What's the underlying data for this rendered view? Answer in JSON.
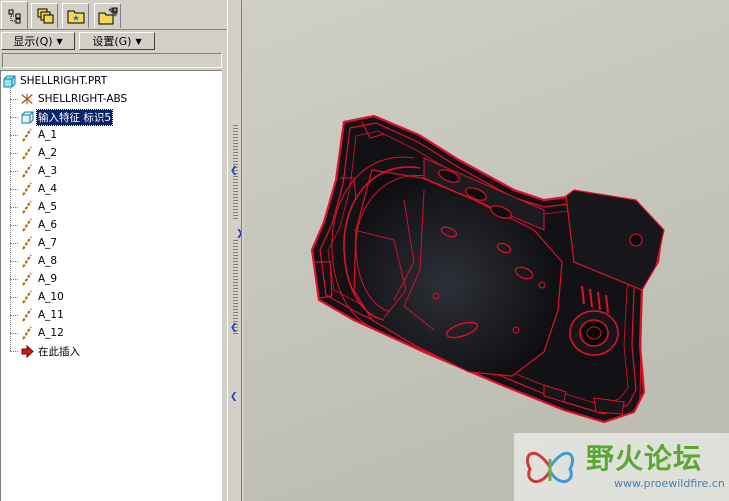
{
  "tabs": [
    {
      "icon": "model-tree-icon"
    },
    {
      "icon": "layers-icon"
    },
    {
      "icon": "folder-browser-icon"
    },
    {
      "icon": "favorites-icon"
    }
  ],
  "toolbar": {
    "show_label": "显示(Q)",
    "settings_label": "设置(G)"
  },
  "tree": {
    "root": "SHELLRIGHT.PRT",
    "items": [
      {
        "label": "SHELLRIGHT-ABS",
        "icon": "coordinate-system-icon",
        "selected": false
      },
      {
        "label": "输入特征 标识5",
        "icon": "import-feature-icon",
        "selected": true
      },
      {
        "label": "A_1",
        "icon": "datum-axis-icon",
        "selected": false
      },
      {
        "label": "A_2",
        "icon": "datum-axis-icon",
        "selected": false
      },
      {
        "label": "A_3",
        "icon": "datum-axis-icon",
        "selected": false
      },
      {
        "label": "A_4",
        "icon": "datum-axis-icon",
        "selected": false
      },
      {
        "label": "A_5",
        "icon": "datum-axis-icon",
        "selected": false
      },
      {
        "label": "A_6",
        "icon": "datum-axis-icon",
        "selected": false
      },
      {
        "label": "A_7",
        "icon": "datum-axis-icon",
        "selected": false
      },
      {
        "label": "A_8",
        "icon": "datum-axis-icon",
        "selected": false
      },
      {
        "label": "A_9",
        "icon": "datum-axis-icon",
        "selected": false
      },
      {
        "label": "A_10",
        "icon": "datum-axis-icon",
        "selected": false
      },
      {
        "label": "A_11",
        "icon": "datum-axis-icon",
        "selected": false
      },
      {
        "label": "A_12",
        "icon": "datum-axis-icon",
        "selected": false
      },
      {
        "label": "在此插入",
        "icon": "insert-here-arrow-icon",
        "selected": false
      }
    ]
  },
  "watermark": {
    "title": "野火论坛",
    "url": "www.proewildfire.cn"
  },
  "colors": {
    "selection": "#0a246a",
    "model_edges": "#e0102a",
    "model_body": "#141418"
  }
}
